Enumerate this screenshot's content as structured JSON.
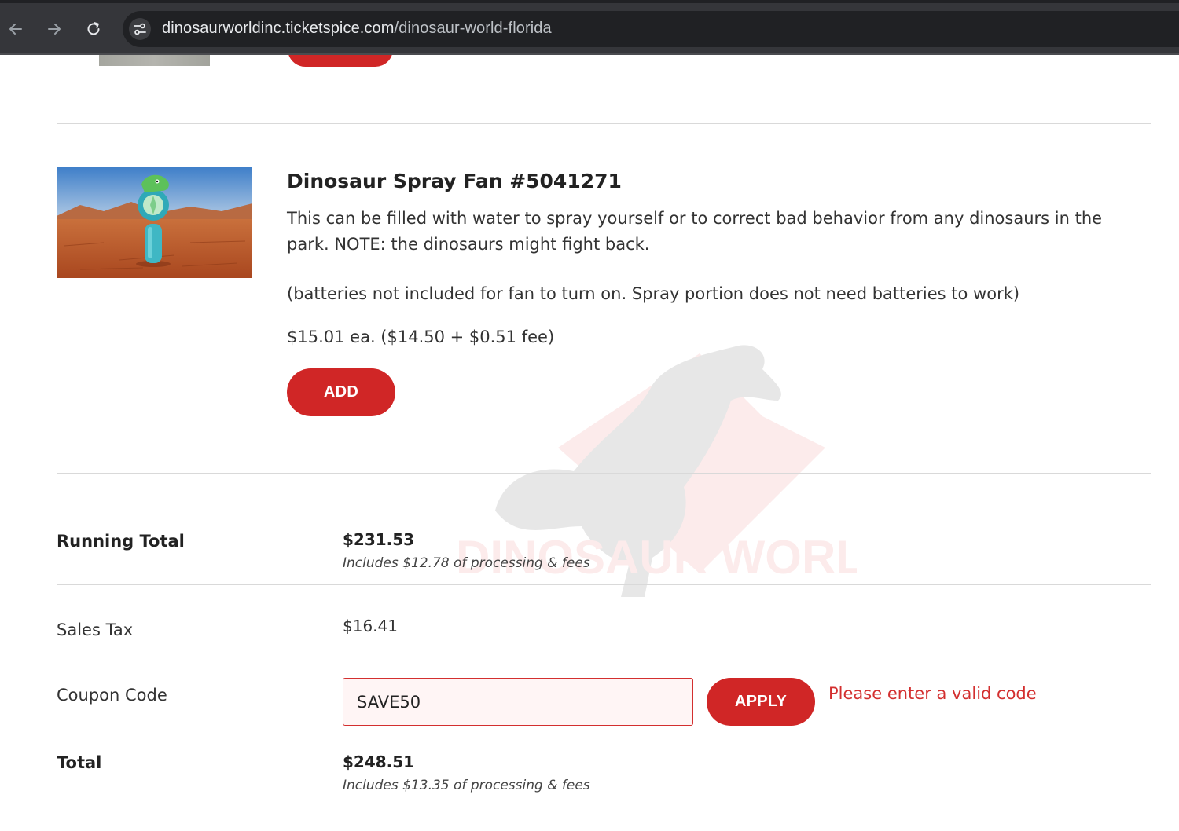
{
  "browser": {
    "url_host": "dinosaurworldinc.ticketspice.com",
    "url_path": "/dinosaur-world-florida"
  },
  "product": {
    "title": "Dinosaur Spray Fan #5041271",
    "description": "This can be filled with water to spray yourself or to correct bad behavior from any dinosaurs in the park. NOTE: the dinosaurs might fight back.",
    "note": "(batteries not included for fan to turn on. Spray portion does not need batteries to work)",
    "price": "$15.01 ea. ($14.50 + $0.51 fee)",
    "add_label": "ADD"
  },
  "summary": {
    "running_total": {
      "label": "Running Total",
      "value": "$231.53",
      "note": "Includes $12.78 of processing & fees"
    },
    "sales_tax": {
      "label": "Sales Tax",
      "value": "$16.41"
    },
    "coupon": {
      "label": "Coupon Code",
      "value": "SAVE50",
      "apply_label": "APPLY",
      "error": "Please enter a valid code"
    },
    "total": {
      "label": "Total",
      "value": "$248.51",
      "note": "Includes $13.35 of processing & fees"
    }
  },
  "watermark": {
    "text": "DINOSAUR WORLD"
  },
  "colors": {
    "accent_red": "#d02626",
    "error_red": "#d32f2f",
    "browser_bar": "#35363a",
    "omnibox": "#202124"
  },
  "icons": {
    "back": "arrow-left-icon",
    "forward": "arrow-right-icon",
    "reload": "reload-icon",
    "site_info": "tune-icon"
  }
}
